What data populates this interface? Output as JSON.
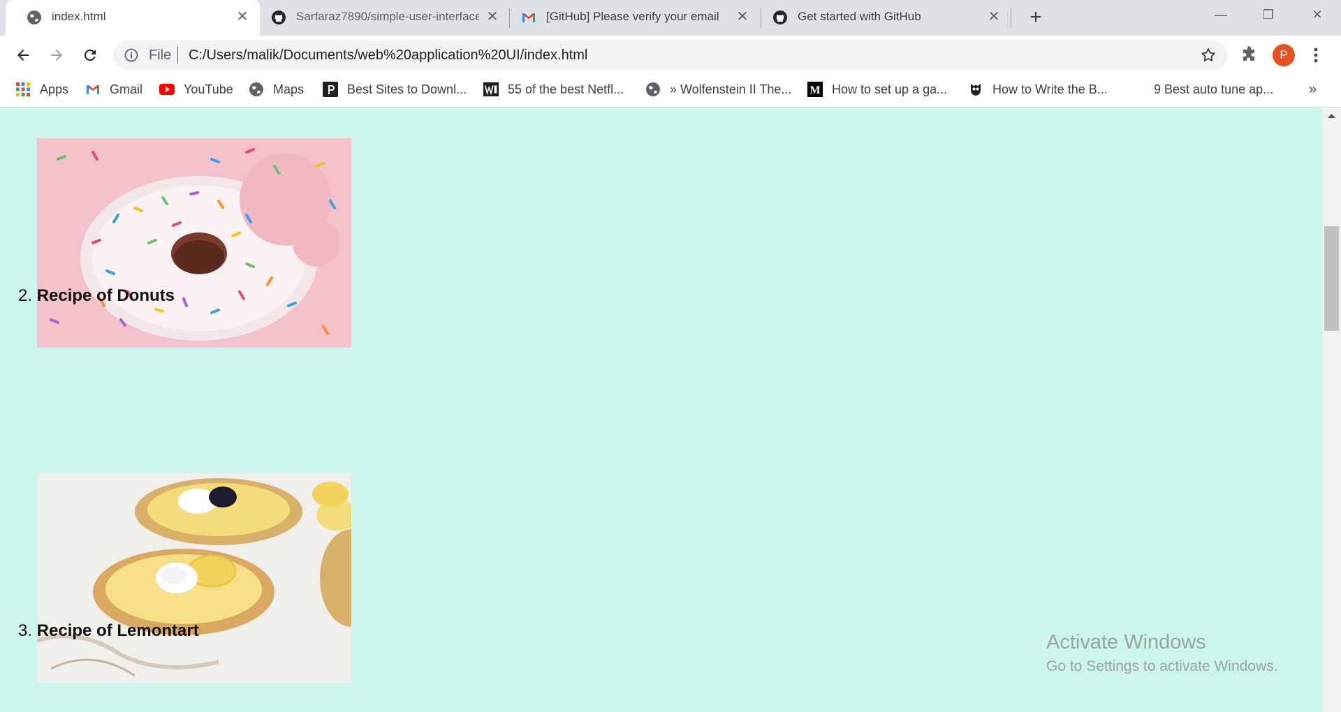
{
  "browser": {
    "tabs": [
      {
        "title": "index.html",
        "favicon": "globe-icon",
        "active": true
      },
      {
        "title": "Sarfaraz7890/simple-user-interface",
        "favicon": "github-icon",
        "active": false
      },
      {
        "title": "[GitHub] Please verify your email",
        "favicon": "gmail-icon",
        "active": false
      },
      {
        "title": "Get started with GitHub",
        "favicon": "github-icon",
        "active": false
      }
    ],
    "address": {
      "scheme": "File",
      "url": "C:/Users/malik/Documents/web%20application%20UI/index.html"
    },
    "profile_initial": "P",
    "profile_color": "#e8501e",
    "bookmarks": [
      {
        "label": "Apps",
        "icon": "apps-grid-icon"
      },
      {
        "label": "Gmail",
        "icon": "gmail-icon"
      },
      {
        "label": "YouTube",
        "icon": "youtube-icon"
      },
      {
        "label": "Maps",
        "icon": "globe-icon"
      },
      {
        "label": "Best Sites to Downl...",
        "icon": "site-icon"
      },
      {
        "label": "55 of the best Netfl...",
        "icon": "wired-icon"
      },
      {
        "label": "» Wolfenstein II The...",
        "icon": "globe-icon"
      },
      {
        "label": "How to set up a ga...",
        "icon": "medium-icon"
      },
      {
        "label": "How to Write the B...",
        "icon": "owl-icon"
      },
      {
        "label": "9 Best auto tune ap...",
        "icon": "blank-icon"
      }
    ],
    "bookmarks_overflow": "»"
  },
  "page": {
    "background": "#ccf5eb",
    "recipes": [
      {
        "number": "2.",
        "name": "Recipe of Donuts",
        "image": "donut-photo"
      },
      {
        "number": "3.",
        "name": "Recipe of Lemontart",
        "image": "lemon-tart-photo"
      }
    ]
  },
  "watermark": {
    "line1": "Activate Windows",
    "line2": "Go to Settings to activate Windows."
  }
}
